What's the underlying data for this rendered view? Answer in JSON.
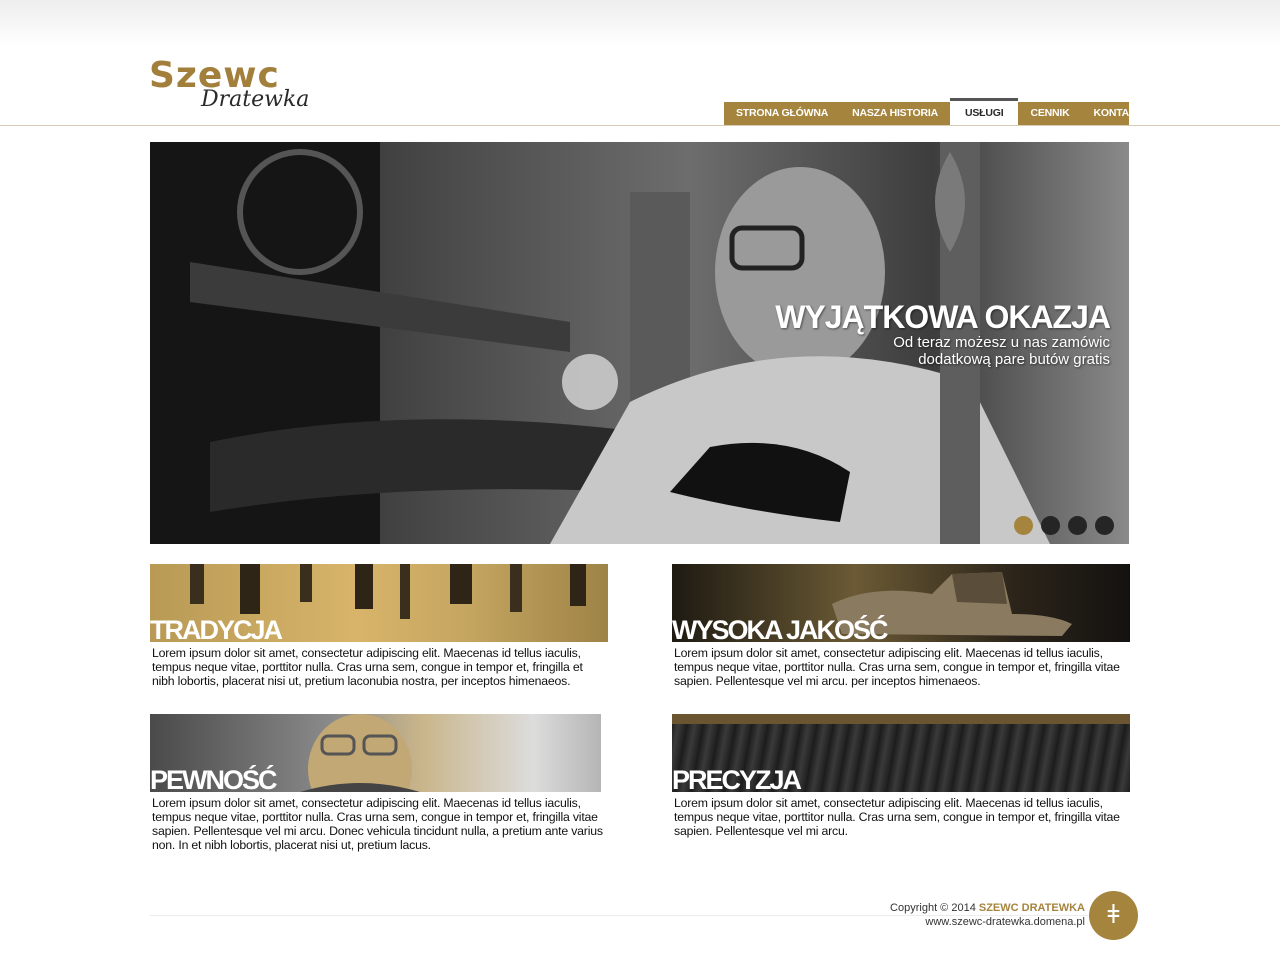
{
  "logo": {
    "main": "Szewc",
    "sub": "Dratewka"
  },
  "nav": {
    "items": [
      {
        "label": "STRONA GŁÓWNA"
      },
      {
        "label": "NASZA HISTORIA"
      },
      {
        "label": "USŁUGI"
      },
      {
        "label": "CENNIK"
      },
      {
        "label": "KONTAKT"
      }
    ],
    "active": "USŁUGI"
  },
  "hero": {
    "title": "WYJĄTKOWA OKAZJA",
    "subtitle": "Od teraz możesz u nas zamówic dodatkową pare butów gratis",
    "slides": 4,
    "active_slide": 1
  },
  "features": [
    {
      "title": "TRADYCJA",
      "text": "Lorem ipsum dolor sit amet, consectetur adipiscing elit. Maecenas id tellus iaculis, tempus neque vitae, porttitor nulla. Cras urna sem, congue in tempor et, fringilla et nibh lobortis, placerat nisi ut, pretium laconubia nostra, per inceptos himenaeos."
    },
    {
      "title": "WYSOKA JAKOŚĆ",
      "text": "Lorem ipsum dolor sit amet, consectetur adipiscing elit. Maecenas id tellus iaculis, tempus neque vitae, porttitor nulla. Cras urna sem, congue in tempor et, fringilla vitae sapien. Pellentesque vel mi arcu. per inceptos himenaeos."
    },
    {
      "title": "PEWNOŚĆ",
      "text": "Lorem ipsum dolor sit amet, consectetur adipiscing elit. Maecenas id tellus iaculis, tempus neque vitae, porttitor nulla. Cras urna sem, congue in tempor et, fringilla vitae sapien. Pellentesque vel mi arcu. Donec vehicula tincidunt nulla, a pretium ante varius non. In et nibh lobortis, placerat nisi ut, pretium lacus."
    },
    {
      "title": "PRECYZJA",
      "text": "Lorem ipsum dolor sit amet, consectetur adipiscing elit. Maecenas id tellus iaculis, tempus neque vitae, porttitor nulla. Cras urna sem, congue in tempor et, fringilla vitae sapien. Pellentesque vel mi arcu."
    }
  ],
  "footer": {
    "copyright": "Copyright © 2014",
    "brand": "SZEWC DRATEWKA",
    "url": "www.szewc-dratewka.domena.pl",
    "badge_glyph": "ǂ"
  },
  "colors": {
    "accent": "#a5843e",
    "dark": "#252525",
    "text": "#111111"
  }
}
